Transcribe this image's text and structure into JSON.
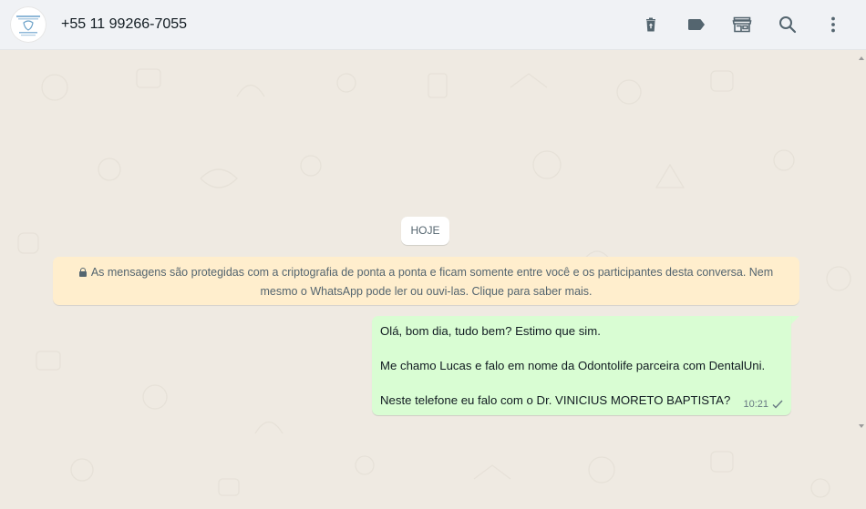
{
  "header": {
    "contact_name": "+55 11 99266-7055",
    "icons": [
      "delete-icon",
      "label-icon",
      "catalog-store-icon",
      "search-icon",
      "menu-icon"
    ]
  },
  "chat": {
    "date_pill": "HOJE",
    "encryption_notice_line1": "As mensagens são protegidas com a criptografia de ponta a ponta e ficam somente entre você e os participantes desta conversa. Nem",
    "encryption_notice_line2": "mesmo o WhatsApp pode ler ou ouvi-las. Clique para saber mais.",
    "message": {
      "lines": [
        "Olá, bom dia, tudo bem? Estimo que sim.",
        "Me chamo Lucas e falo em nome da Odontolife parceira com DentalUni.",
        "Neste telefone eu falo com o Dr. VINICIUS MORETO BAPTISTA?"
      ],
      "time": "10:21",
      "status": "sent"
    }
  },
  "colors": {
    "header_bg": "#f0f2f5",
    "chat_bg": "#efeae2",
    "outgoing_bubble": "#d9fdd3",
    "notice_bg": "#ffeecd",
    "icon_color": "#54656f"
  }
}
